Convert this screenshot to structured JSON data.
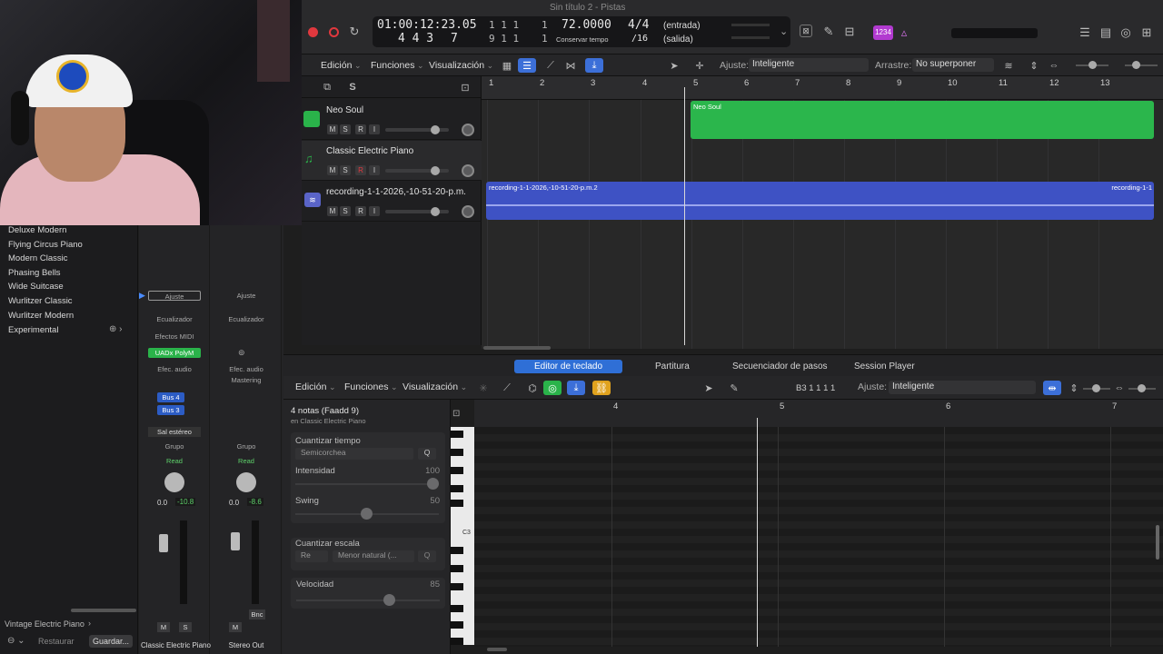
{
  "window": {
    "title": "Sin título 2 - Pistas"
  },
  "lcd": {
    "time": "01:00:12:23.05",
    "bars": "4  4  3",
    "ticks_top": "1 1 1",
    "ticks_top_last": "1",
    "sub": "7",
    "ticks_bot": "9 1 1",
    "ticks_bot_last": "1",
    "tempo": "72.0000",
    "tempo_label": "Conservar tempo",
    "sig": "4/4",
    "div": "/16",
    "in": "(entrada)",
    "out": "(salida)",
    "count_in": "1234"
  },
  "toolbar": {
    "edit": "Edición",
    "functions": "Funciones",
    "view": "Visualización",
    "snap_label": "Ajuste:",
    "snap_value": "Inteligente",
    "drag_label": "Arrastre:",
    "drag_value": "No superponer"
  },
  "tracks": [
    {
      "name": "Neo Soul",
      "color": "#2ab34a"
    },
    {
      "name": "Classic Electric Piano",
      "color": "#2ab34a"
    },
    {
      "name": "recording-1-1-2026,-10-51-20-p.m.",
      "color": "#4a5ac8"
    }
  ],
  "track_buttons": {
    "m": "M",
    "s": "S",
    "r": "R",
    "i": "I"
  },
  "ruler": [
    "1",
    "2",
    "3",
    "4",
    "5",
    "6",
    "7",
    "8",
    "9",
    "10",
    "11",
    "12",
    "13"
  ],
  "regions": {
    "neo": "Neo Soul",
    "rec": "recording-1-1-2026,-10-51-20-p.m.2",
    "rec_right": "recording-1-1"
  },
  "library": {
    "items": [
      "Deluxe Modern",
      "Flying Circus Piano",
      "Modern Classic",
      "Phasing Bells",
      "Wide Suitcase",
      "Wurlitzer Classic",
      "Wurlitzer Modern",
      "Experimental"
    ],
    "footer_patch": "Vintage Electric Piano",
    "restore": "Restaurar",
    "save": "Guardar..."
  },
  "mixer": {
    "strip1": {
      "setting": "Ajuste",
      "eq": "Ecualizador",
      "midi": "Efectos MIDI",
      "plugin": "UADx PolyM",
      "audio_fx": "Efec. audio",
      "bus1": "Bus 4",
      "bus2": "Bus 3",
      "output": "Sal estéreo",
      "group": "Grupo",
      "auto": "Read",
      "pan": "0.0",
      "level": "-10.8",
      "m": "M",
      "s": "S",
      "name": "Classic Electric Piano"
    },
    "strip2": {
      "setting": "Ajuste",
      "eq": "Ecualizador",
      "audio_fx": "Efec. audio",
      "mastering": "Mastering",
      "group": "Grupo",
      "auto": "Read",
      "pan": "0.0",
      "level": "-8.6",
      "m": "M",
      "bnc": "Bnc",
      "name": "Stereo Out"
    }
  },
  "editor": {
    "tabs": [
      "Editor de teclado",
      "Partitura",
      "Secuenciador de pasos",
      "Session Player"
    ],
    "edit": "Edición",
    "functions": "Funciones",
    "view": "Visualización",
    "position": "B3  1 1 1 1",
    "snap_label": "Ajuste:",
    "snap_value": "Inteligente",
    "notes_title": "4 notas (Faadd 9)",
    "notes_sub": "en Classic Electric Piano",
    "quant_time": "Cuantizar tiempo",
    "quant_value": "Semicorchea",
    "q": "Q",
    "intensity": "Intensidad",
    "intensity_val": "100",
    "swing": "Swing",
    "swing_val": "50",
    "quant_scale": "Cuantizar escala",
    "scale_root": "Re",
    "scale_mode": "Menor natural (...",
    "velocity": "Velocidad",
    "velocity_val": "85",
    "key_label": "C3",
    "ruler": [
      "4",
      "5",
      "6",
      "7"
    ]
  }
}
